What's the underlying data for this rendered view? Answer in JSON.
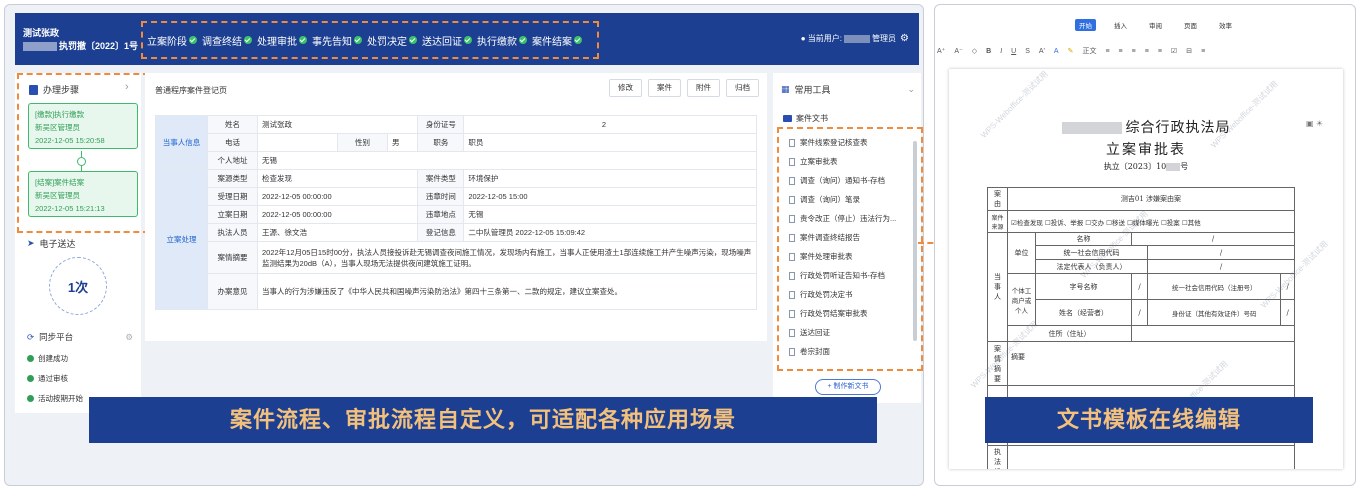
{
  "header": {
    "case_name": "测试张政",
    "case_number": "执罚撤〔2022〕1号",
    "stages": [
      "立案阶段",
      "调查终结",
      "处理审批",
      "事先告知",
      "处罚决定",
      "送达回证",
      "执行缴款",
      "案件结案"
    ],
    "user_prefix": "当前用户:",
    "user_suffix": "管理员"
  },
  "steps": {
    "title": "办理步骤",
    "cards": [
      {
        "line1": "[缴款]执行缴款",
        "line2": "新吴区管理员",
        "line3": "2022-12-05 15:20:58"
      },
      {
        "line1": "[结案]案件结案",
        "line2": "新吴区管理员",
        "line3": "2022-12-05 15:21:13"
      }
    ]
  },
  "esend": {
    "title": "电子送达",
    "count": "1次"
  },
  "sync": {
    "title": "同步平台",
    "items": [
      "创建成功",
      "通过审核",
      "活动按期开始"
    ]
  },
  "mid": {
    "title": "普通程序案件登记页",
    "buttons": [
      "修改",
      "案件",
      "附件",
      "归档"
    ],
    "party_group": "当事人信息",
    "case_group": "立案处理",
    "labels": {
      "name": "姓名",
      "id_no": "身份证号",
      "phone": "电话",
      "gender": "性别",
      "job": "职务",
      "address": "个人地址",
      "source": "案源类型",
      "case_type": "案件类型",
      "accept_date": "受理日期",
      "violation_time": "违章时间",
      "register_date": "立案日期",
      "violation_place": "违章地点",
      "officers": "执法人员",
      "register_info": "登记信息",
      "summary": "案情摘要",
      "opinion": "办案意见"
    },
    "values": {
      "name": "测试张政",
      "id_no_tail": "2",
      "gender": "男",
      "job": "职员",
      "address": "无锡",
      "source": "检查发现",
      "case_type": "环境保护",
      "accept_date": "2022-12-05 00:00:00",
      "violation_time": "2022-12-05 15:00",
      "register_date": "2022-12-05 00:00:00",
      "violation_place": "无锡",
      "officers": "王源、徐文浩",
      "register_info": "二中队管理员 2022-12-05 15:09:42",
      "summary": "2022年12月05日15时00分，执法人员接投诉赴无锡调查夜间施工情况，发现场内有施工，当事人正使用渣土1部连续施工并产生噪声污染，现场噪声监测结果为20dB（A），当事人现场无法提供夜间建筑施工证明。",
      "opinion": "当事人的行为涉嫌违反了《中华人民共和国噪声污染防治法》第四十三条第一、二款的规定，建议立案查处。"
    }
  },
  "tools": {
    "title": "常用工具",
    "docs_title": "案件文书",
    "docs": [
      "案件线索登记核查表",
      "立案审批表",
      "调查（询问）通知书-存档",
      "调查（询问）笔录",
      "责令改正（停止）违法行为...",
      "案件调查终结报告",
      "案件处理审批表",
      "行政处罚听证告知书-存档",
      "行政处罚决定书",
      "行政处罚结案审批表",
      "送达回证",
      "卷宗封面"
    ],
    "new_doc": "+ 制作新文书"
  },
  "banners": {
    "left": "案件流程、审批流程自定义，可适配各种应用场景",
    "right": "文书模板在线编辑"
  },
  "editor": {
    "tabs": [
      "开始",
      "插入",
      "审阅",
      "页面",
      "效率"
    ],
    "toolbar": [
      "A⁺",
      "A⁻",
      "◇",
      "B",
      "I",
      "U",
      "S",
      "A'",
      "A",
      "✎",
      "正文",
      "≡",
      "≡",
      "≡",
      "≡",
      "≡",
      "☑",
      "⊟",
      "≡"
    ],
    "doc_title_suffix": "综合行政执法局",
    "doc_subtitle": "立案审批表",
    "doc_number_prefix": "执立〔2023〕10",
    "doc_number_suffix": "号",
    "watermark": "WPS-Weboffice-测试试用",
    "row_case_label": "案由",
    "row_case_value": "测吉01 涉嫌案由案",
    "row_source_label": "案件来源",
    "row_source_value": "☑检查发现 ☐投诉、举报 ☐交办 ☐移送 ☐媒体曝光 ☐投案 ☐其他",
    "party_label": "当事人",
    "unit_label": "单位",
    "name_label": "名称",
    "credit_label": "统一社会信用代码",
    "legal_label": "法定代表人（负责人）",
    "indiv_label": "个体工商户或个人",
    "shop_label": "字号名称",
    "credit_label2": "统一社会信用代码（注册号）",
    "person_label": "姓名（经营者）",
    "idcard_label": "身份证（其他有效证件）号码",
    "address_label": "住所（住址）",
    "summary_label": "案情摘要",
    "summary_value": "摘要",
    "org_label": "执法机构",
    "slash": "/"
  }
}
